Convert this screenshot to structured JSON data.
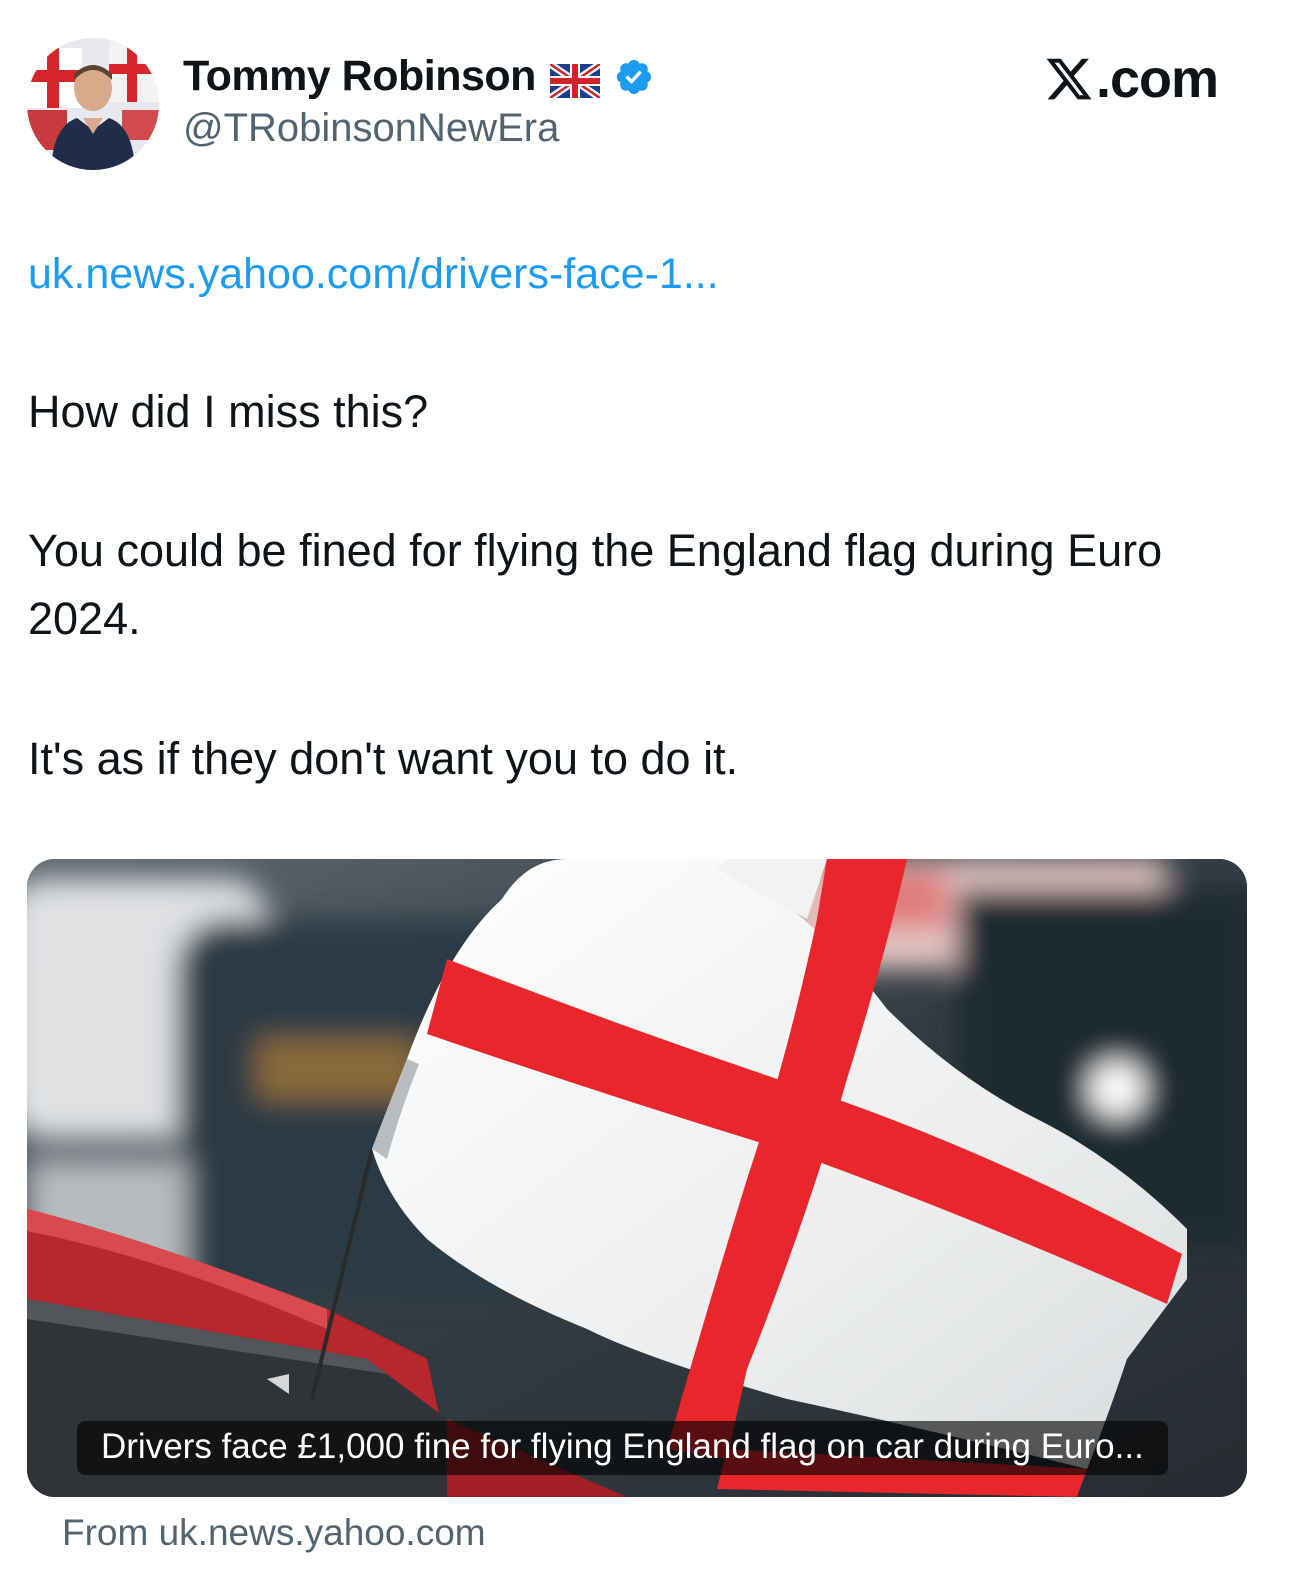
{
  "author": {
    "display_name": "Tommy Robinson",
    "handle": "@TRobinsonNewEra",
    "flag_icon": "uk-flag-emoji",
    "verified_icon": "verified-badge-icon",
    "verified_color": "#1d9bf0"
  },
  "brand": {
    "label": ".com"
  },
  "tweet": {
    "link_text": "uk.news.yahoo.com/drivers-face-1...",
    "line_1": "How did I miss this?",
    "line_2": "You could be fined for flying the England flag during Euro 2024.",
    "line_3": "It's as if they don't want you to do it."
  },
  "card": {
    "caption": "Drivers face £1,000 fine for flying England flag on car during Euro...",
    "source": "From uk.news.yahoo.com"
  },
  "colors": {
    "link": "#1d9bf0",
    "secondary_text": "#536471",
    "flag_red": "#e8262b"
  }
}
